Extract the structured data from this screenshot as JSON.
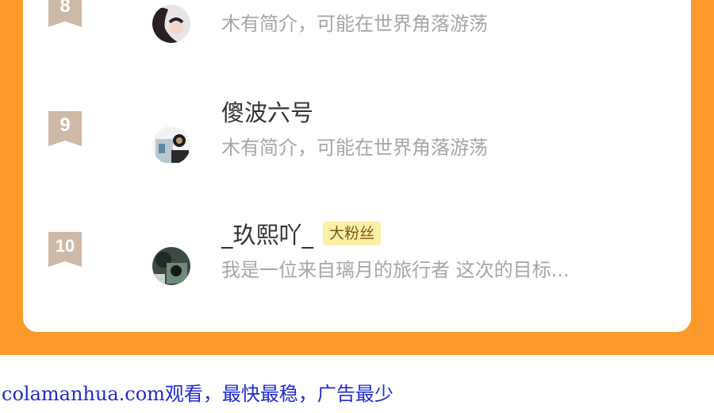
{
  "colors": {
    "background_orange": "#fb9a2b",
    "card": "#ffffff",
    "rank_badge": "#cdb9a6",
    "fan_badge_bg": "#fcefa6",
    "fan_badge_text": "#7a5a14",
    "name_text": "#333333",
    "bio_text": "#a6a6a6",
    "watermark": "#1f2bd0"
  },
  "fan_list": [
    {
      "rank": "8",
      "name": "",
      "badge": "",
      "bio": "木有简介，可能在世界角落游荡"
    },
    {
      "rank": "9",
      "name": "傻波六号",
      "badge": "",
      "bio": "木有简介，可能在世界角落游荡"
    },
    {
      "rank": "10",
      "name": "_玖熙吖_",
      "badge": "大粉丝",
      "bio": "我是一位来自璃月的旅行者 这次的目标..."
    }
  ],
  "watermark": "colamanhua.com观看，最快最稳，广告最少"
}
